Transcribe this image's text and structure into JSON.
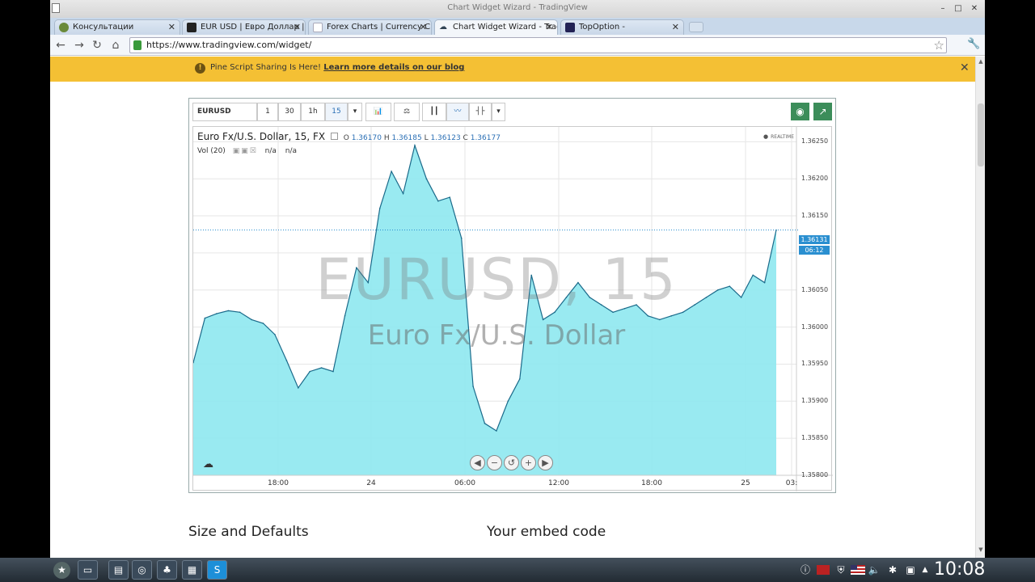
{
  "browser": {
    "window_title": "Chart Widget Wizard - TradingView",
    "tabs": [
      {
        "label": "Консультации",
        "icon": "globe-icon",
        "icon_color": "#6a8a3a"
      },
      {
        "label": "EUR USD | Евро Доллар |",
        "icon": "site-icon",
        "icon_color": "#222"
      },
      {
        "label": "Forex Charts | Currency Ch",
        "icon": "page-icon",
        "icon_color": "#aab"
      },
      {
        "label": "Chart Widget Wizard - Trad",
        "icon": "cloud-icon",
        "icon_color": "#345"
      },
      {
        "label": "TopOption -",
        "icon": "site-icon",
        "icon_color": "#225"
      }
    ],
    "active_tab": 3,
    "url": "https://www.tradingview.com/widget/"
  },
  "notification": {
    "text": "Pine Script Sharing Is Here!",
    "link": "Learn more details on our blog",
    "bg_color": "#f4c034"
  },
  "widget": {
    "symbol": "EURUSD",
    "intervals": [
      "1",
      "30",
      "1h",
      "15"
    ],
    "selected_interval": "15"
  },
  "chart": {
    "legend_title": "Euro Fx/U.S. Dollar, 15, FX",
    "open_label": "O",
    "open": "1.36170",
    "high_label": "H",
    "high": "1.36185",
    "low_label": "L",
    "low": "1.36123",
    "close_label": "C",
    "close": "1.36177",
    "volume_label": "Vol (20)",
    "volume_value1": "n/a",
    "volume_value2": "n/a",
    "realtime_label": "REALTIME",
    "watermark_symbol": "EURUSD, 15",
    "watermark_name": "Euro Fx/U.S. Dollar",
    "current_price": "1.36131",
    "countdown": "06:12"
  },
  "chart_data": {
    "type": "area",
    "x_ticks": [
      "18:00",
      "24",
      "06:00",
      "12:00",
      "18:00",
      "25",
      "03:"
    ],
    "y_ticks": [
      "1.36250",
      "1.36200",
      "1.36150",
      "1.36100",
      "1.36050",
      "1.36000",
      "1.35950",
      "1.35900",
      "1.35850",
      "1.35800"
    ],
    "ylim": [
      1.358,
      1.3627
    ],
    "area_color": "#8ee8ef",
    "line_color": "#1a6a8a",
    "x": [
      0,
      2,
      4,
      6,
      8,
      10,
      12,
      14,
      16,
      18,
      20,
      22,
      24,
      26,
      28,
      30,
      32,
      34,
      36,
      38,
      40,
      42,
      44,
      46,
      48,
      50,
      52,
      54,
      56,
      58,
      60,
      62,
      64,
      66,
      68,
      70,
      72,
      74,
      76,
      78,
      80,
      82,
      84,
      86,
      88,
      90,
      92,
      94,
      96,
      98,
      100
    ],
    "values": [
      1.35952,
      1.36012,
      1.36018,
      1.36022,
      1.3602,
      1.3601,
      1.36005,
      1.3599,
      1.35955,
      1.35918,
      1.3594,
      1.35945,
      1.3594,
      1.36015,
      1.3608,
      1.3606,
      1.3616,
      1.3621,
      1.3618,
      1.36245,
      1.362,
      1.3617,
      1.36175,
      1.3612,
      1.3592,
      1.3587,
      1.3586,
      1.359,
      1.3593,
      1.3607,
      1.3601,
      1.3602,
      1.3604,
      1.3606,
      1.3604,
      1.3603,
      1.3602,
      1.36025,
      1.3603,
      1.36015,
      1.3601,
      1.36015,
      1.3602,
      1.3603,
      1.3604,
      1.3605,
      1.36055,
      1.3604,
      1.3607,
      1.3606,
      1.36131
    ]
  },
  "sections": {
    "size_defaults": "Size and Defaults",
    "embed_code": "Your embed code"
  },
  "taskbar": {
    "clock": "10:08",
    "apps": [
      "desktop-icon",
      "files-icon",
      "chrome-icon",
      "game-icon",
      "media-icon",
      "skype-icon"
    ]
  }
}
